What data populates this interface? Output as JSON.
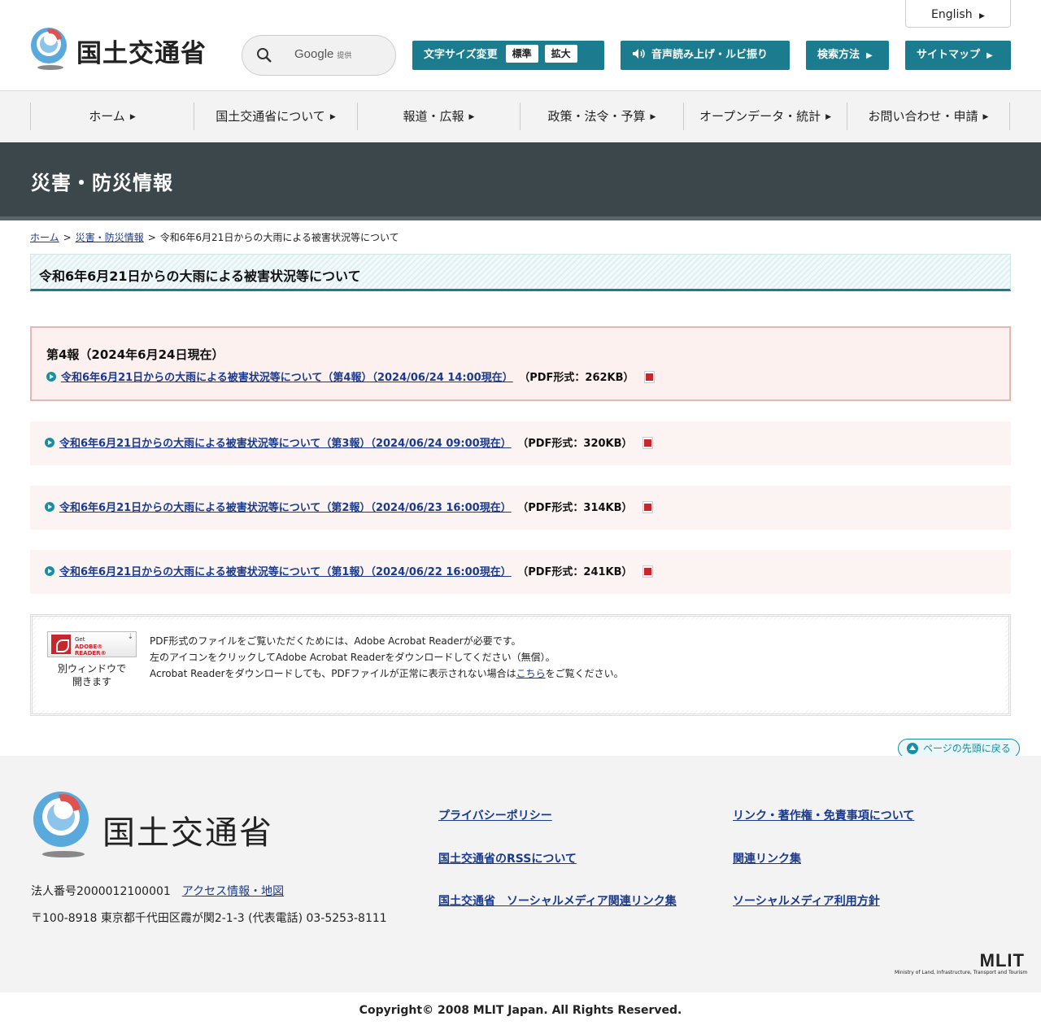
{
  "header": {
    "logo_text": "国土交通省",
    "search": {
      "google_label": "Google",
      "google_sub": "提供"
    },
    "english_label": "English",
    "font_size": {
      "label": "文字サイズ変更",
      "standard": "標準",
      "large": "拡大"
    },
    "read_aloud_label": "音声読み上げ・ルビ振り",
    "search_method_label": "検索方法",
    "sitemap_label": "サイトマップ"
  },
  "nav": {
    "items": [
      {
        "label": "ホーム"
      },
      {
        "label": "国土交通省について"
      },
      {
        "label": "報道・広報"
      },
      {
        "label": "政策・法令・予算"
      },
      {
        "label": "オープンデータ・統計"
      },
      {
        "label": "お問い合わせ・申請"
      }
    ]
  },
  "section_title": "災害・防災情報",
  "breadcrumb": {
    "home": "ホーム",
    "sep": ">",
    "disaster": "災害・防災情報",
    "current": "令和6年6月21日からの大雨による被害状況等について"
  },
  "page_heading": "令和6年6月21日からの大雨による被害状況等について",
  "reports": {
    "latest_heading": "第4報（2024年6月24日現在）",
    "items": [
      {
        "link": "令和6年6月21日からの大雨による被害状況等について（第4報）（2024/06/24 14:00現在）",
        "format": "（PDF形式：262KB）"
      },
      {
        "link": "令和6年6月21日からの大雨による被害状況等について（第3報）（2024/06/24 09:00現在）",
        "format": "（PDF形式：320KB）"
      },
      {
        "link": "令和6年6月21日からの大雨による被害状況等について（第2報）（2024/06/23 16:00現在）",
        "format": "（PDF形式：314KB）"
      },
      {
        "link": "令和6年6月21日からの大雨による被害状況等について（第1報）（2024/06/22 16:00現在）",
        "format": "（PDF形式：241KB）"
      }
    ]
  },
  "acrobat": {
    "badge_get": "Get",
    "badge_reader": "ADOBE® READER®",
    "caption_line1": "別ウィンドウで",
    "caption_line2": "開きます",
    "line1": "PDF形式のファイルをご覧いただくためには、Adobe Acrobat Readerが必要です。",
    "line2": "左のアイコンをクリックしてAdobe Acrobat Readerをダウンロードしてください（無償）。",
    "line3_pre": "Acrobat Readerをダウンロードしても、PDFファイルが正常に表示されない場合は",
    "line3_link": "こちら",
    "line3_post": "をご覧ください。"
  },
  "page_top_label": "ページの先頭に戻る",
  "footer": {
    "logo_text": "国土交通省",
    "corp_number": "法人番号2000012100001",
    "access_link": "アクセス情報・地図",
    "address": "〒100-8918 東京都千代田区霞が関2-1-3 (代表電話) 03-5253-8111",
    "links": [
      "プライバシーポリシー",
      "リンク・著作権・免責事項について",
      "国土交通省のRSSについて",
      "関連リンク集",
      "国土交通省　ソーシャルメディア関連リンク集",
      "ソーシャルメディア利用方針"
    ],
    "mlit_mark": "MLIT",
    "mlit_sub": "Ministry of Land, Infrastructure, Transport and Tourism",
    "copyright": "Copyright© 2008 MLIT Japan. All Rights Reserved."
  },
  "colors": {
    "accent": "#1a7c8e",
    "title_band": "#3c474c",
    "link": "#1a3a8f",
    "pdf_red": "#c8262d"
  }
}
